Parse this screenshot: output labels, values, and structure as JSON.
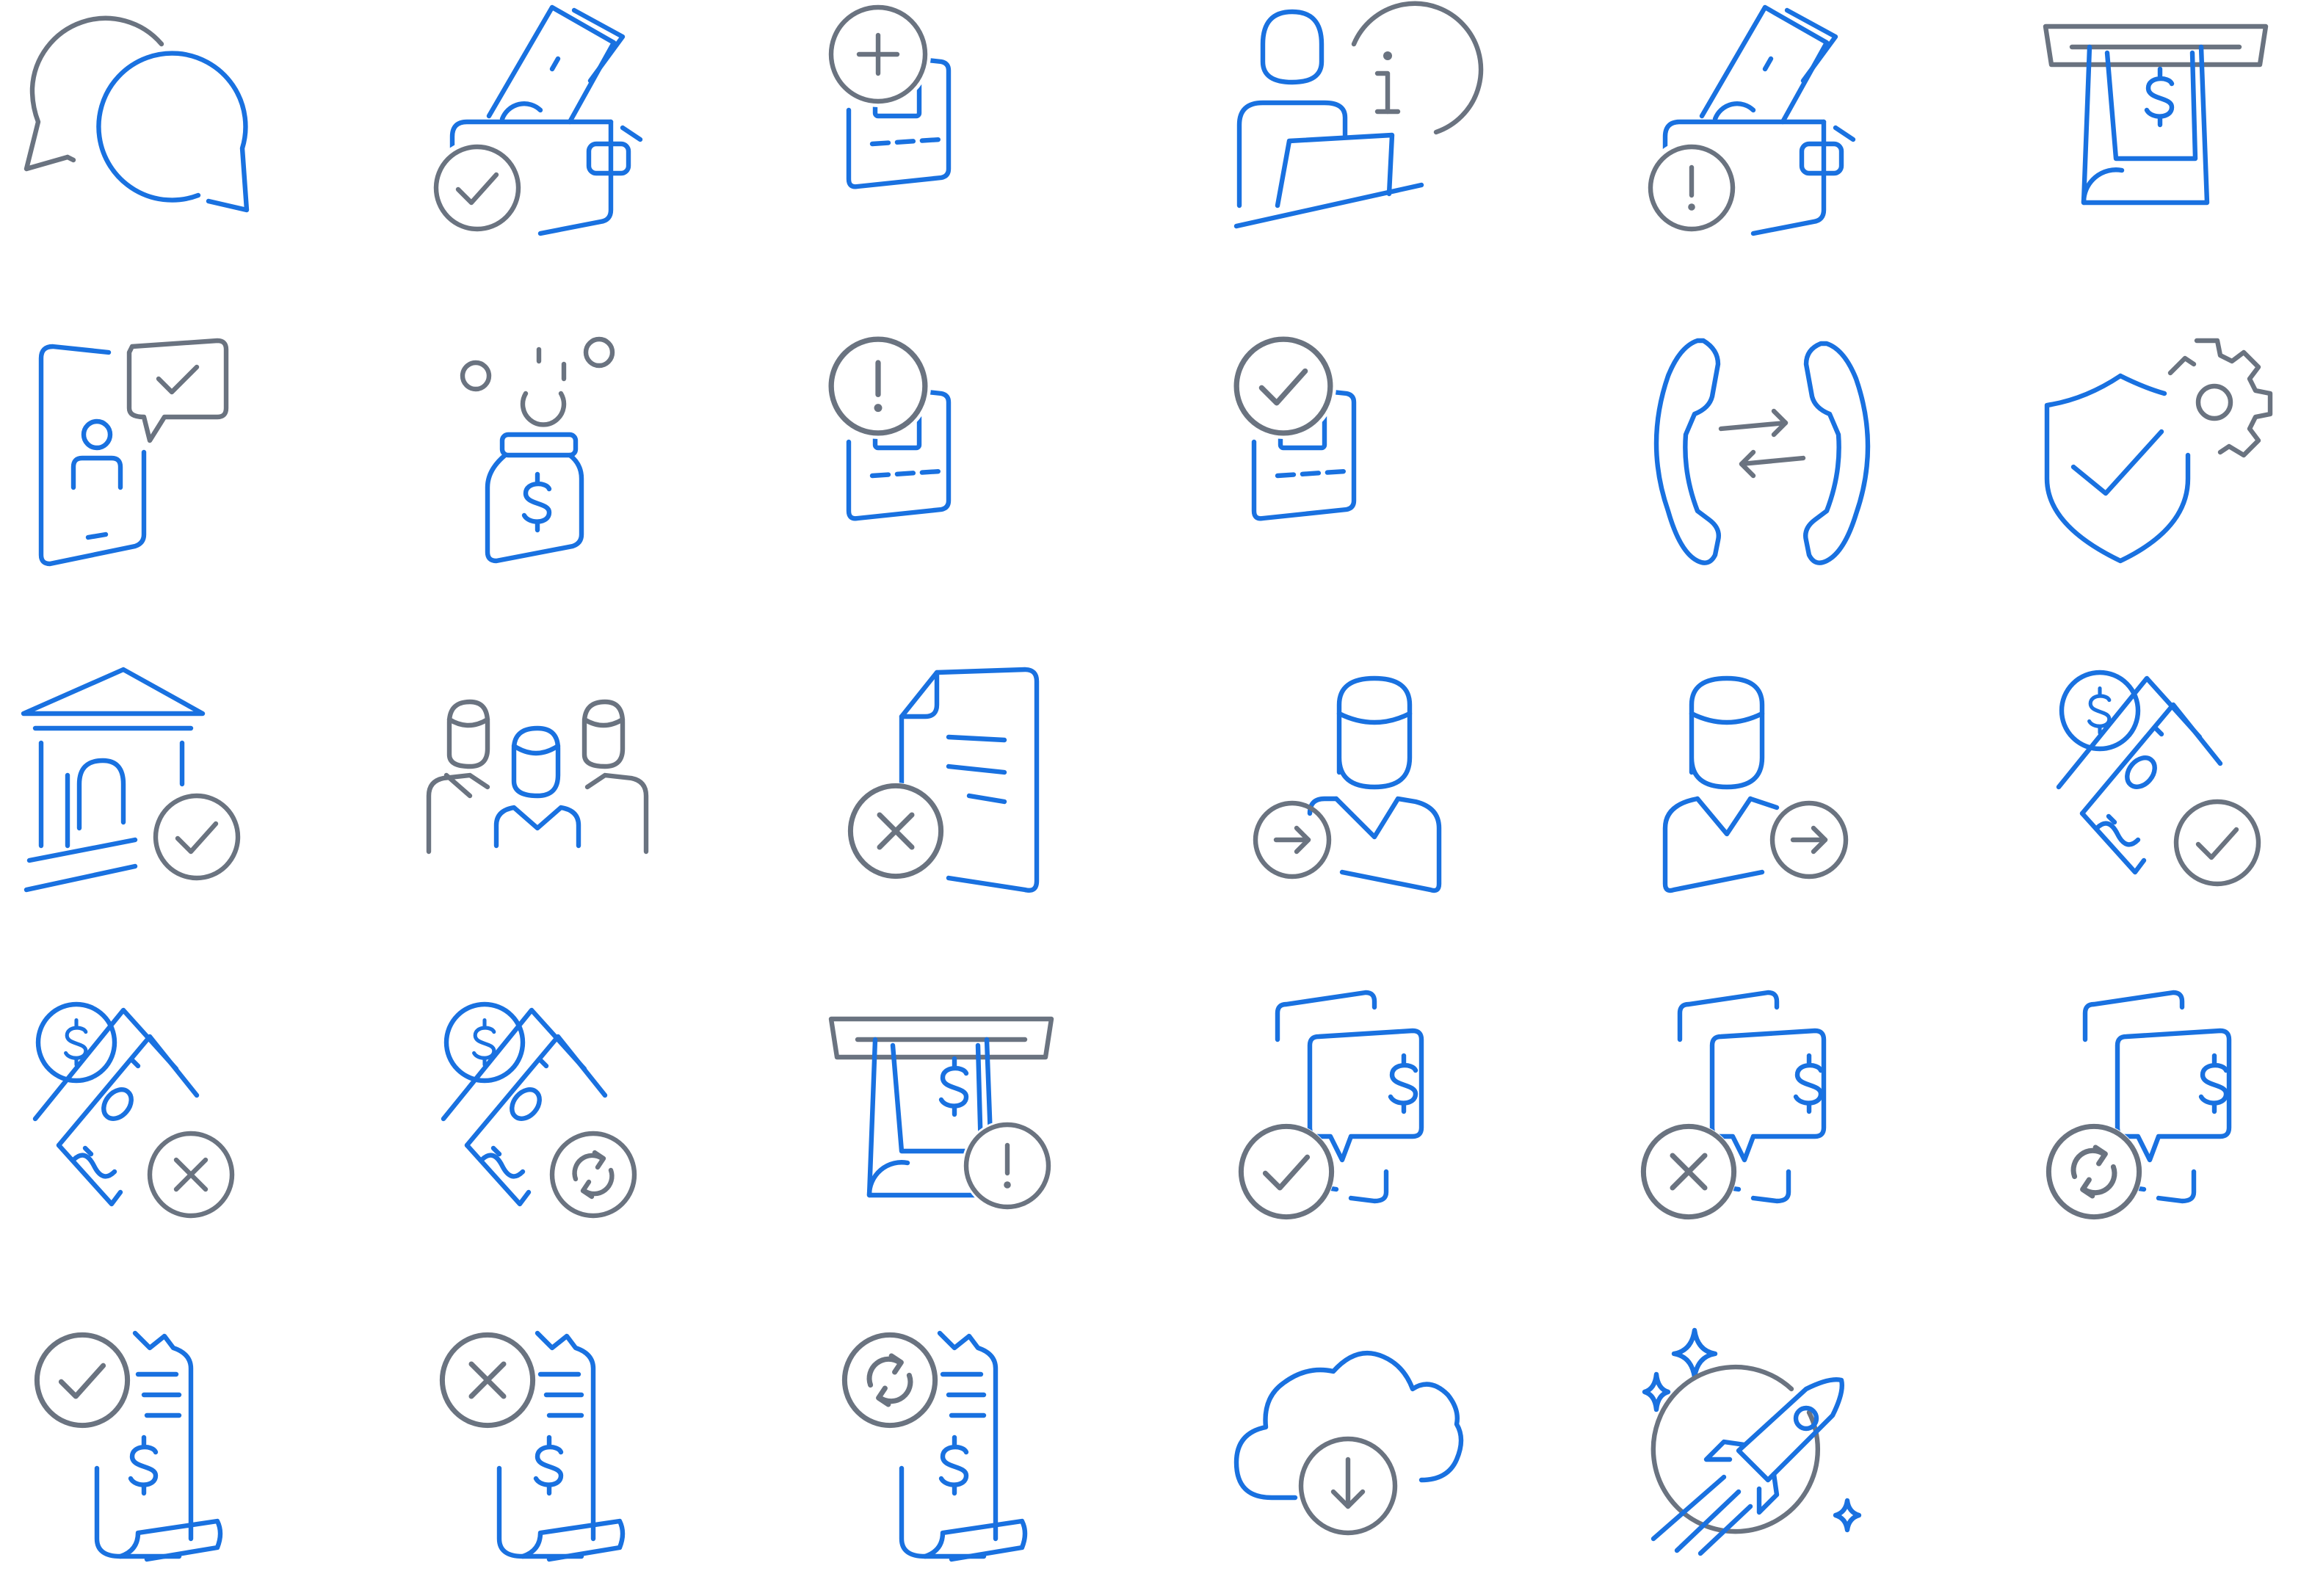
{
  "palette": {
    "accent": "#1971e0",
    "neutral": "#6a7380",
    "background": "#ffffff"
  },
  "rows": [
    {
      "icons": [
        {
          "name": "chat-bubbles-icon"
        },
        {
          "name": "wallet-check-icon"
        },
        {
          "name": "add-card-icon"
        },
        {
          "name": "info-desk-icon"
        },
        {
          "name": "wallet-alert-icon"
        },
        {
          "name": "atm-cash-icon"
        }
      ]
    },
    {
      "icons": [
        {
          "name": "phone-verified-user-icon"
        },
        {
          "name": "money-jar-icon"
        },
        {
          "name": "card-alert-icon"
        },
        {
          "name": "card-check-icon"
        },
        {
          "name": "phone-transfer-icon"
        },
        {
          "name": "shield-settings-icon"
        }
      ]
    },
    {
      "icons": [
        {
          "name": "bank-check-icon"
        },
        {
          "name": "team-icon"
        },
        {
          "name": "document-cancel-icon"
        },
        {
          "name": "user-incoming-icon"
        },
        {
          "name": "user-outgoing-icon"
        },
        {
          "name": "money-check-icon"
        }
      ]
    },
    {
      "icons": [
        {
          "name": "money-cancel-icon"
        },
        {
          "name": "money-refresh-icon"
        },
        {
          "name": "atm-alert-icon"
        },
        {
          "name": "mobile-payment-check-icon"
        },
        {
          "name": "mobile-payment-cancel-icon"
        },
        {
          "name": "mobile-payment-refresh-icon"
        }
      ]
    },
    {
      "icons": [
        {
          "name": "receipt-check-icon"
        },
        {
          "name": "receipt-cancel-icon"
        },
        {
          "name": "receipt-refresh-icon"
        },
        {
          "name": "cloud-download-icon"
        },
        {
          "name": "rocket-launch-icon"
        }
      ]
    }
  ]
}
